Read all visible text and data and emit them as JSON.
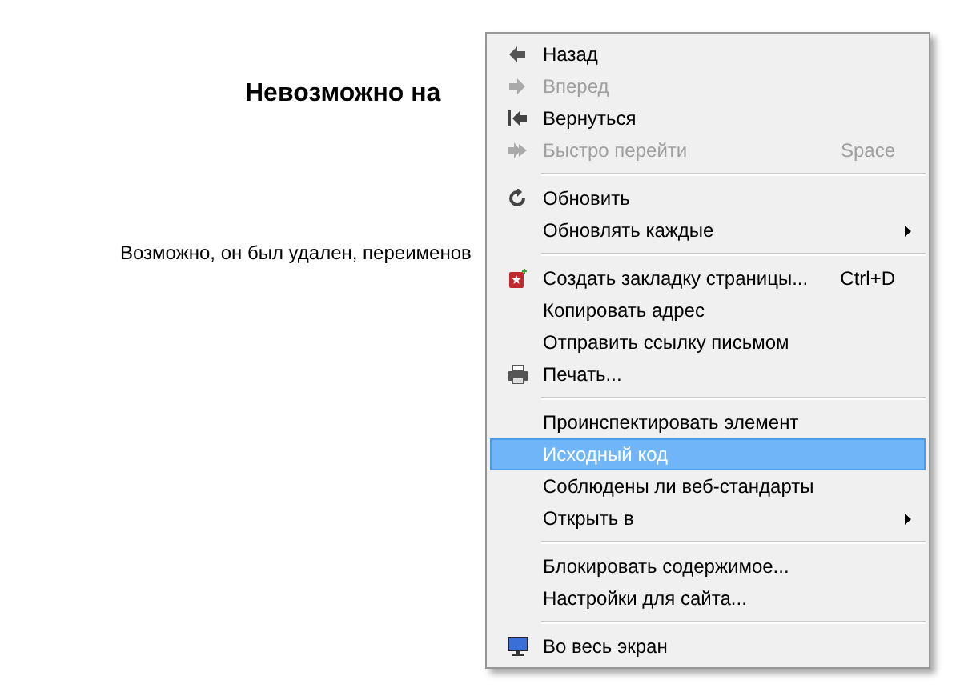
{
  "page": {
    "heading": "Невозможно на",
    "message": "Возможно, он был удален, переименов"
  },
  "context_menu": {
    "items": [
      {
        "kind": "item",
        "label": "Назад",
        "disabled": false,
        "submenu": false,
        "selected": false
      },
      {
        "kind": "item",
        "label": "Вперед",
        "disabled": true,
        "submenu": false,
        "selected": false
      },
      {
        "kind": "item",
        "label": "Вернуться",
        "disabled": false,
        "submenu": false,
        "selected": false
      },
      {
        "kind": "item",
        "label": "Быстро перейти",
        "shortcut": "Space",
        "disabled": true,
        "submenu": false,
        "selected": false
      },
      {
        "kind": "separator"
      },
      {
        "kind": "item",
        "label": "Обновить",
        "disabled": false,
        "submenu": false,
        "selected": false
      },
      {
        "kind": "item",
        "label": "Обновлять каждые",
        "disabled": false,
        "submenu": true,
        "selected": false
      },
      {
        "kind": "separator"
      },
      {
        "kind": "item",
        "label": "Создать закладку страницы...",
        "shortcut": "Ctrl+D",
        "disabled": false,
        "submenu": false,
        "selected": false
      },
      {
        "kind": "item",
        "label": "Копировать адрес",
        "disabled": false,
        "submenu": false,
        "selected": false
      },
      {
        "kind": "item",
        "label": "Отправить ссылку письмом",
        "disabled": false,
        "submenu": false,
        "selected": false
      },
      {
        "kind": "item",
        "label": "Печать...",
        "disabled": false,
        "submenu": false,
        "selected": false
      },
      {
        "kind": "separator"
      },
      {
        "kind": "item",
        "label": "Проинспектировать элемент",
        "disabled": false,
        "submenu": false,
        "selected": false
      },
      {
        "kind": "item",
        "label": "Исходный код",
        "disabled": false,
        "submenu": false,
        "selected": true
      },
      {
        "kind": "item",
        "label": "Соблюдены ли веб-стандарты",
        "disabled": false,
        "submenu": false,
        "selected": false
      },
      {
        "kind": "item",
        "label": "Открыть в",
        "disabled": false,
        "submenu": true,
        "selected": false
      },
      {
        "kind": "separator"
      },
      {
        "kind": "item",
        "label": "Блокировать содержимое...",
        "disabled": false,
        "submenu": false,
        "selected": false
      },
      {
        "kind": "item",
        "label": "Настройки для сайта...",
        "disabled": false,
        "submenu": false,
        "selected": false
      },
      {
        "kind": "separator"
      },
      {
        "kind": "item",
        "label": "Во весь экран",
        "disabled": false,
        "submenu": false,
        "selected": false
      }
    ]
  }
}
